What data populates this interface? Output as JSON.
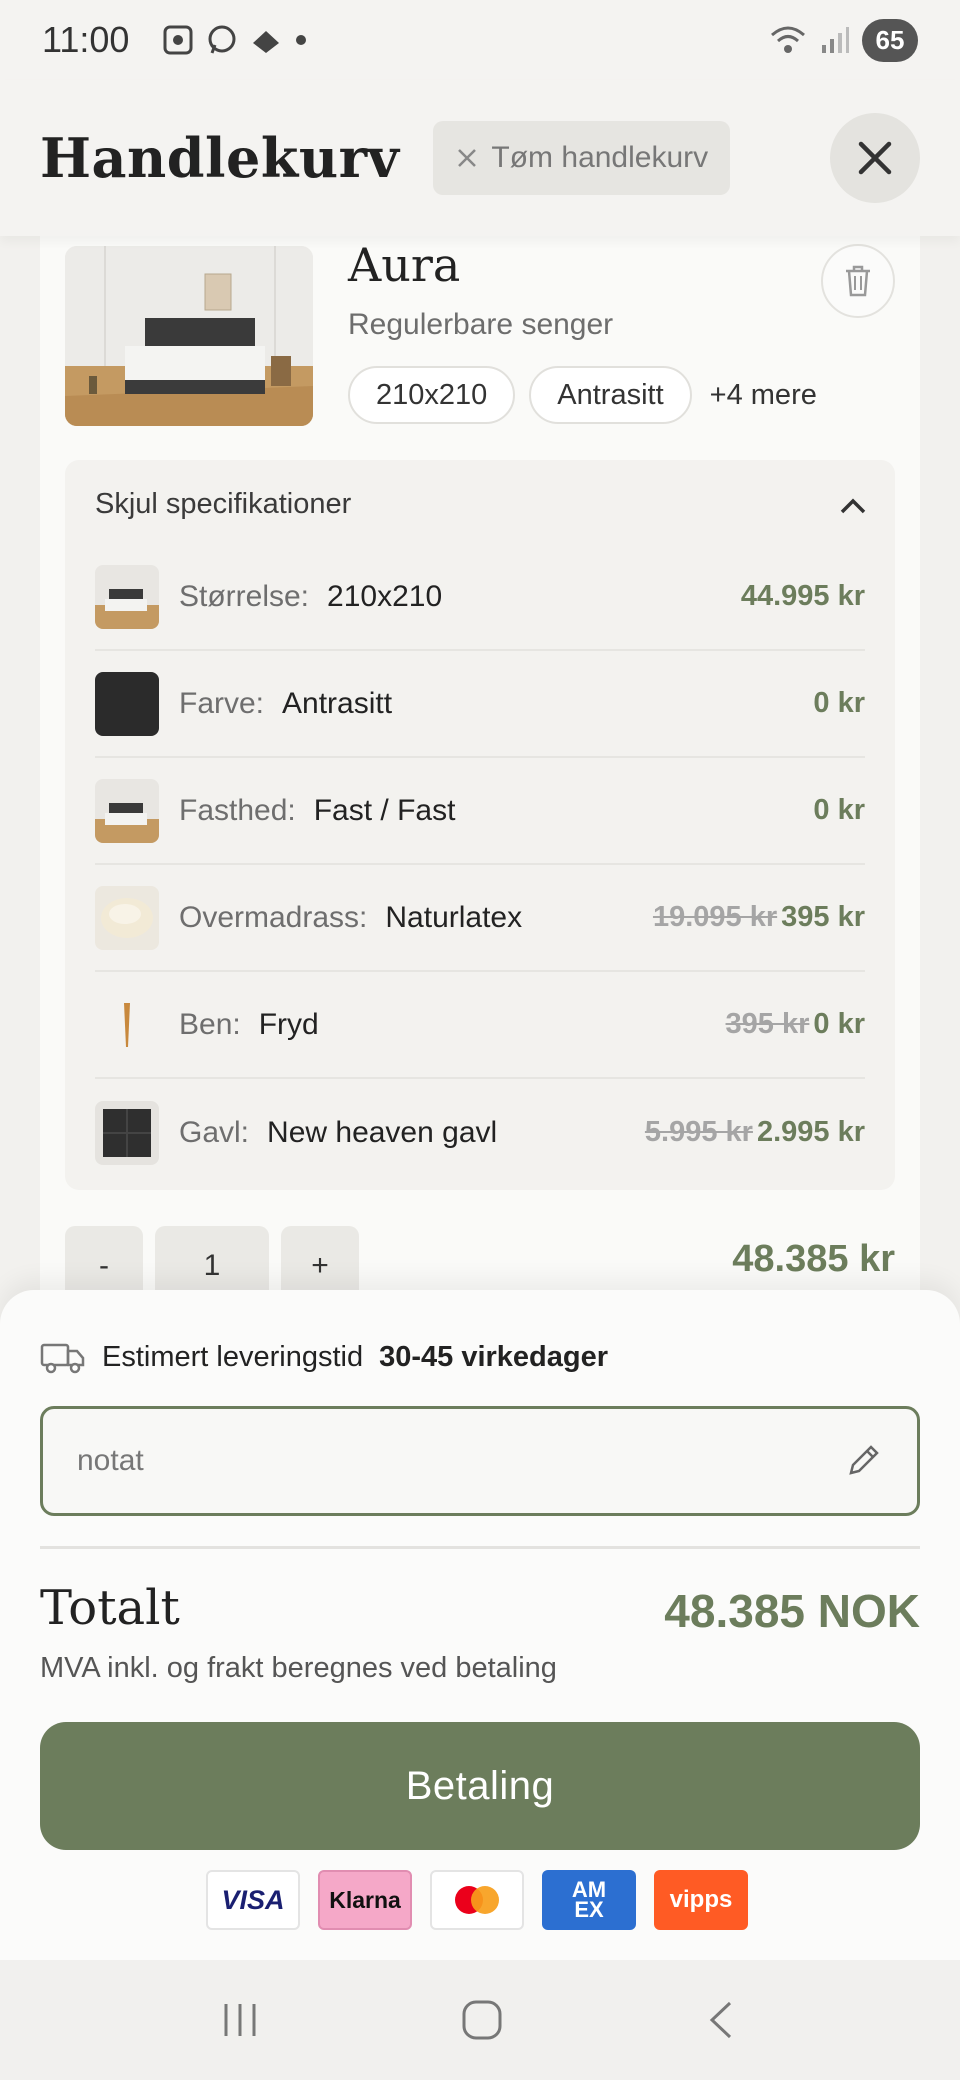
{
  "status_bar": {
    "time": "11:00",
    "battery": "65"
  },
  "header": {
    "title": "Handlekurv",
    "clear_cart_label": "Tøm handlekurv"
  },
  "product": {
    "name": "Aura",
    "category": "Regulerbare senger",
    "chips": [
      "210x210",
      "Antrasitt"
    ],
    "more_label": "+4 mere"
  },
  "specs": {
    "toggle_label": "Skjul specifikationer",
    "rows": [
      {
        "label": "Størrelse:",
        "value": "210x210",
        "old_price": "",
        "price": "44.995 kr"
      },
      {
        "label": "Farve:",
        "value": "Antrasitt",
        "old_price": "",
        "price": "0 kr"
      },
      {
        "label": "Fasthed:",
        "value": "Fast / Fast",
        "old_price": "",
        "price": "0 kr"
      },
      {
        "label": "Overmadrass:",
        "value": "Naturlatex",
        "old_price": "19.095 kr",
        "price": "395 kr"
      },
      {
        "label": "Ben:",
        "value": "Fryd",
        "old_price": "395 kr",
        "price": "0 kr"
      },
      {
        "label": "Gavl:",
        "value": "New heaven gavl",
        "old_price": "5.995 kr",
        "price": "2.995 kr"
      }
    ]
  },
  "quantity": {
    "minus": "-",
    "value": "1",
    "plus": "+",
    "line_total": "48.385 kr"
  },
  "checkout": {
    "delivery_prefix": "Estimert leveringstid",
    "delivery_time": "30-45 virkedager",
    "note_placeholder": "notat",
    "total_label": "Totalt",
    "total_value": "48.385 NOK",
    "vat_note": "MVA inkl. og frakt beregnes ved betaling",
    "pay_label": "Betaling",
    "payment_methods": {
      "visa": "VISA",
      "klarna": "Klarna",
      "amex_top": "AM",
      "amex_bottom": "EX",
      "vipps": "vipps"
    }
  },
  "colors": {
    "accent": "#6c7d5c",
    "background": "#f2f1ee"
  }
}
